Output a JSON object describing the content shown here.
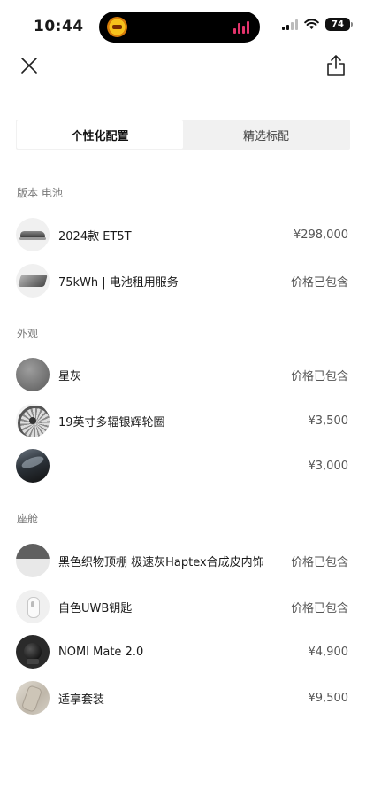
{
  "status_bar": {
    "time": "10:44",
    "battery": "74"
  },
  "tabs": [
    {
      "label": "个性化配置",
      "active": true
    },
    {
      "label": "精选标配",
      "active": false
    }
  ],
  "sections": [
    {
      "title": "版本 电池",
      "items": [
        {
          "label": "2024款 ET5T",
          "price": "¥298,000",
          "thumb": "car-thumbnail"
        },
        {
          "label": "75kWh | 电池租用服务",
          "price": "价格已包含",
          "thumb": "battery-thumbnail"
        }
      ]
    },
    {
      "title": "外观",
      "items": [
        {
          "label": "星灰",
          "price": "价格已包含",
          "thumb": "color-swatch"
        },
        {
          "label": "19英寸多辐银辉轮圈",
          "price": "¥3,500",
          "thumb": "wheel-thumbnail"
        },
        {
          "label": "",
          "price": "¥3,000",
          "thumb": "roof-thumbnail"
        }
      ]
    },
    {
      "title": "座舱",
      "items": [
        {
          "label": "黑色织物顶棚 极速灰Haptex合成皮内饰",
          "price": "价格已包含",
          "thumb": "interior-thumbnail"
        },
        {
          "label": "自色UWB钥匙",
          "price": "价格已包含",
          "thumb": "key-thumbnail"
        },
        {
          "label": "NOMI Mate 2.0",
          "price": "¥4,900",
          "thumb": "nomi-thumbnail"
        },
        {
          "label": "适享套装",
          "price": "¥9,500",
          "thumb": "seat-thumbnail"
        }
      ]
    }
  ]
}
